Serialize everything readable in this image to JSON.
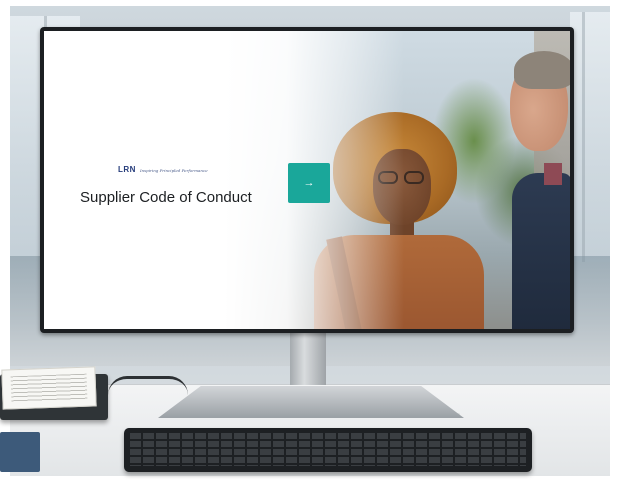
{
  "screen": {
    "logo": {
      "mark": "LRN",
      "tagline": "Inspiring Principled Performance"
    },
    "title": "Supplier Code of Conduct",
    "next_button": {
      "icon": "arrow-right-icon",
      "glyph": "→"
    }
  },
  "colors": {
    "accent": "#1aa79a",
    "logo": "#243b7a",
    "title_text": "#1c1f22"
  }
}
